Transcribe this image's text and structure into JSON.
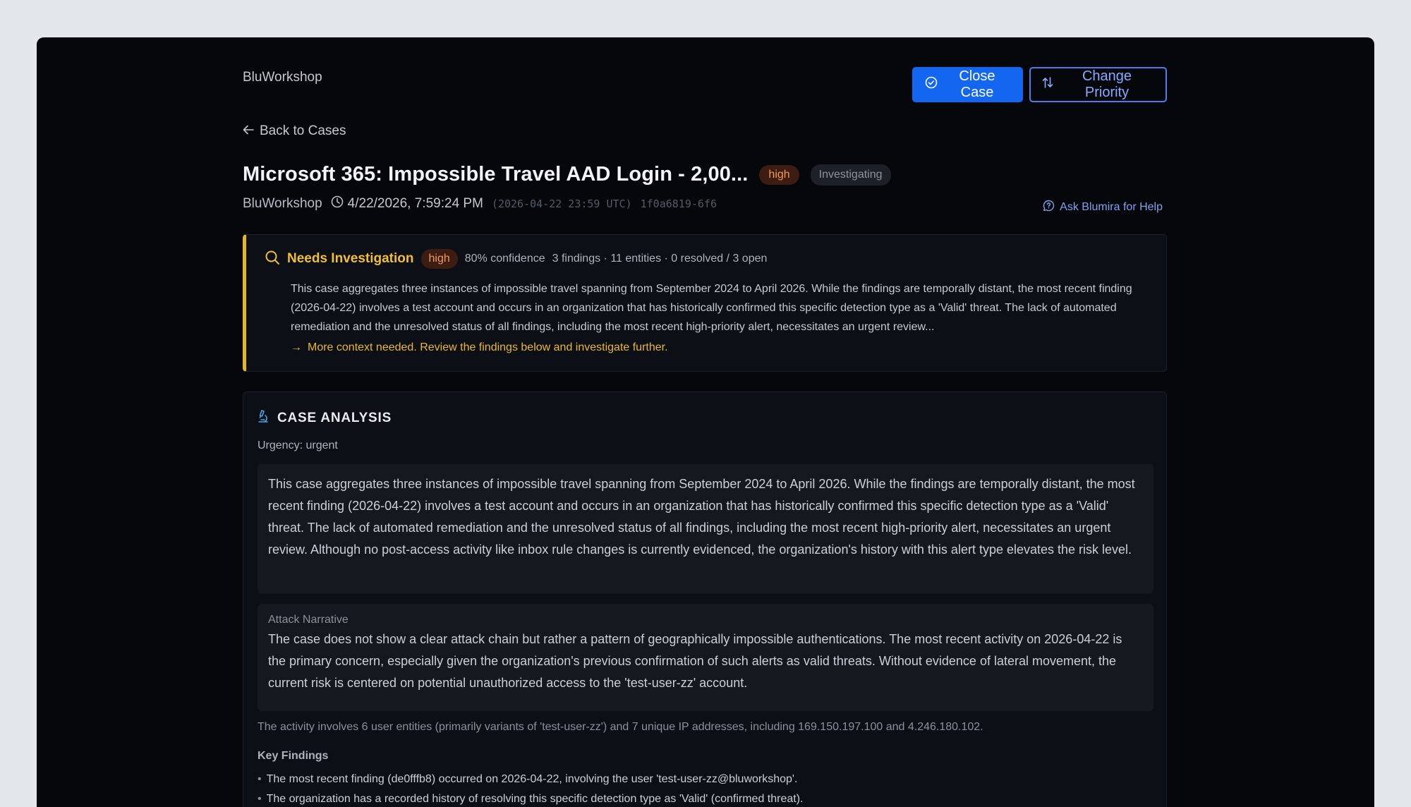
{
  "app": {
    "brand": "BluWorkshop"
  },
  "header": {
    "close_case_label": "Close Case",
    "change_priority_label": "Change Priority",
    "back_label": "Back to Cases"
  },
  "case": {
    "title": "Microsoft 365: Impossible Travel AAD Login - 2,00...",
    "severity": "high",
    "status": "Investigating",
    "org": "BluWorkshop",
    "local_time": "4/22/2026, 7:59:24 PM",
    "utc_time": "(2026-04-22 23:59 UTC)",
    "case_id": "1f0a6819-6f6",
    "ask_help_label": "Ask Blumira for Help"
  },
  "investigation": {
    "title": "Needs Investigation",
    "severity": "high",
    "confidence": "80% confidence",
    "stats": "3 findings · 11 entities · 0 resolved / 3 open",
    "body": "This case aggregates three instances of impossible travel spanning from September 2024 to April 2026. While the findings are temporally distant, the most recent finding (2026-04-22) involves a test account and occurs in an organization that has historically confirmed this specific detection type as a 'Valid' threat. The lack of automated remediation and the unresolved status of all findings, including the most recent high-priority alert, necessitates an urgent review...",
    "action_arrow": "→",
    "action_text": "More context needed. Review the findings below and investigate further."
  },
  "analysis": {
    "title": "CASE ANALYSIS",
    "urgency": "Urgency: urgent",
    "summary": "This case aggregates three instances of impossible travel spanning from September 2024 to April 2026. While the findings are temporally distant, the most recent finding (2026-04-22) involves a test account and occurs in an organization that has historically confirmed this specific detection type as a 'Valid' threat. The lack of automated remediation and the unresolved status of all findings, including the most recent high-priority alert, necessitates an urgent review. Although no post-access activity like inbox rule changes is currently evidenced, the organization's history with this alert type elevates the risk level.",
    "narrative_label": "Attack Narrative",
    "narrative": "The case does not show a clear attack chain but rather a pattern of geographically impossible authentications. The most recent activity on 2026-04-22 is the primary concern, especially given the organization's previous confirmation of such alerts as valid threats. Without evidence of lateral movement, the current risk is centered on potential unauthorized access to the 'test-user-zz' account.",
    "entities": "The activity involves 6 user entities (primarily variants of 'test-user-zz') and 7 unique IP addresses, including 169.150.197.100 and 4.246.180.102.",
    "key_findings_label": "Key Findings",
    "key_findings": [
      "The most recent finding (de0fffb8) occurred on 2026-04-22, involving the user 'test-user-zz@bluworkshop'.",
      "The organization has a recorded history of resolving this specific detection type as 'Valid' (confirmed threat)."
    ]
  },
  "colors": {
    "primary": "#1366f0",
    "warning": "#e6b628",
    "high": "#f29a5a"
  }
}
